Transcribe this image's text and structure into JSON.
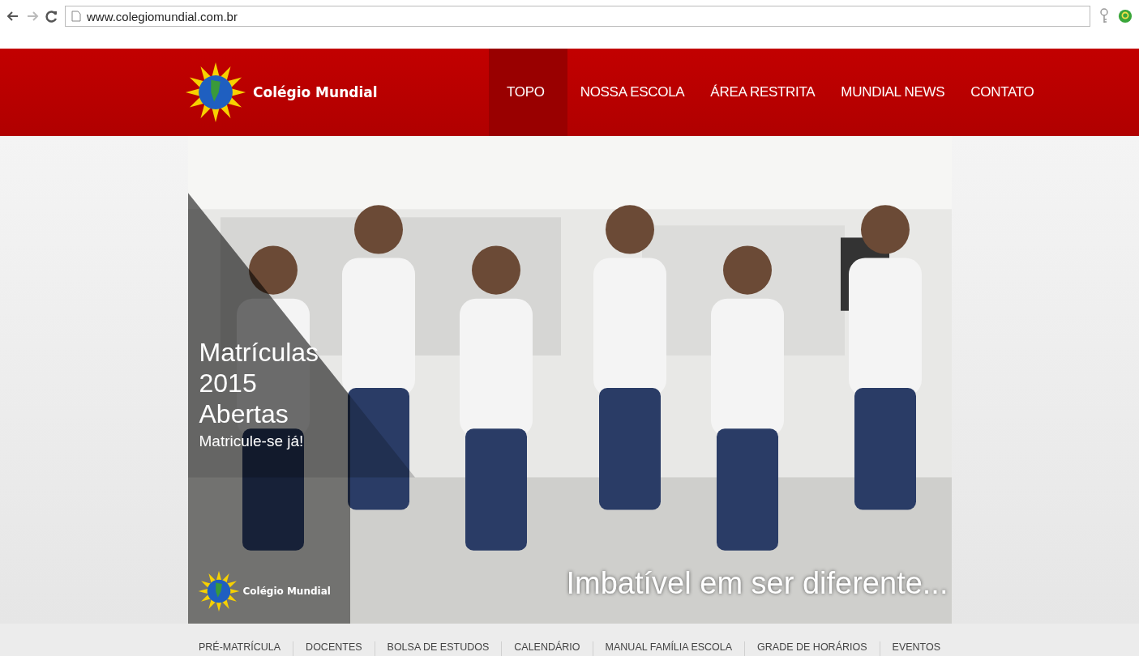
{
  "browser": {
    "url": "www.colegiomundial.com.br"
  },
  "header": {
    "brand": "Colégio Mundial",
    "nav": [
      {
        "label": "TOPO",
        "selected": true
      },
      {
        "label": "NOSSA ESCOLA",
        "selected": false
      },
      {
        "label": "ÁREA RESTRITA",
        "selected": false
      },
      {
        "label": "MUNDIAL NEWS",
        "selected": false
      },
      {
        "label": "CONTATO",
        "selected": false
      }
    ]
  },
  "banner": {
    "headline": [
      "Matrículas",
      "2015",
      "Abertas"
    ],
    "subline": "Matricule-se já!",
    "brand": "Colégio Mundial",
    "slogan": "Imbatível em ser diferente..."
  },
  "subnav": [
    "PRÉ-MATRÍCULA",
    "DOCENTES",
    "BOLSA DE ESTUDOS",
    "CALENDÁRIO",
    "MANUAL FAMÍLIA ESCOLA",
    "GRADE DE HORÁRIOS",
    "EVENTOS"
  ]
}
